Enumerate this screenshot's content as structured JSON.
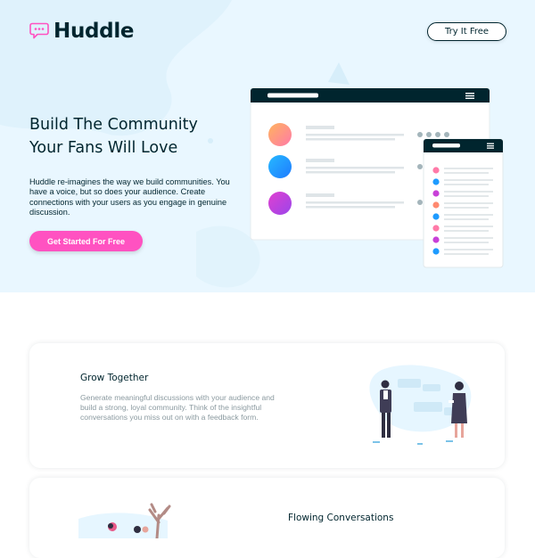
{
  "header": {
    "logo_text": "Huddle",
    "try_button_label": "Try It Free"
  },
  "hero": {
    "title_line1": "Build The Community",
    "title_line2": "Your Fans Will Love",
    "description": "Huddle re-imagines the way we build communities. You have a voice, but so does your audience. Create connections with your users as you engage in genuine discussion.",
    "cta_label": "Get Started For Free"
  },
  "features": [
    {
      "title": "Grow Together",
      "description": "Generate meaningful discussions with your audience and build a strong, loyal community. Think of the insightful conversations you miss out on with a feedback form."
    },
    {
      "title": "Flowing Conversations",
      "description": ""
    }
  ],
  "colors": {
    "accent_pink": "#ff52c1",
    "dark_navy": "#00252e",
    "hero_bg": "#e9f7ff",
    "body_text_gray": "#8b9aa0"
  },
  "icons": {
    "logo": "chat-bubble-icon",
    "mockup": "app-mockup-illustration",
    "feature1": "people-discussion-illustration",
    "feature2": "tree-people-illustration"
  }
}
